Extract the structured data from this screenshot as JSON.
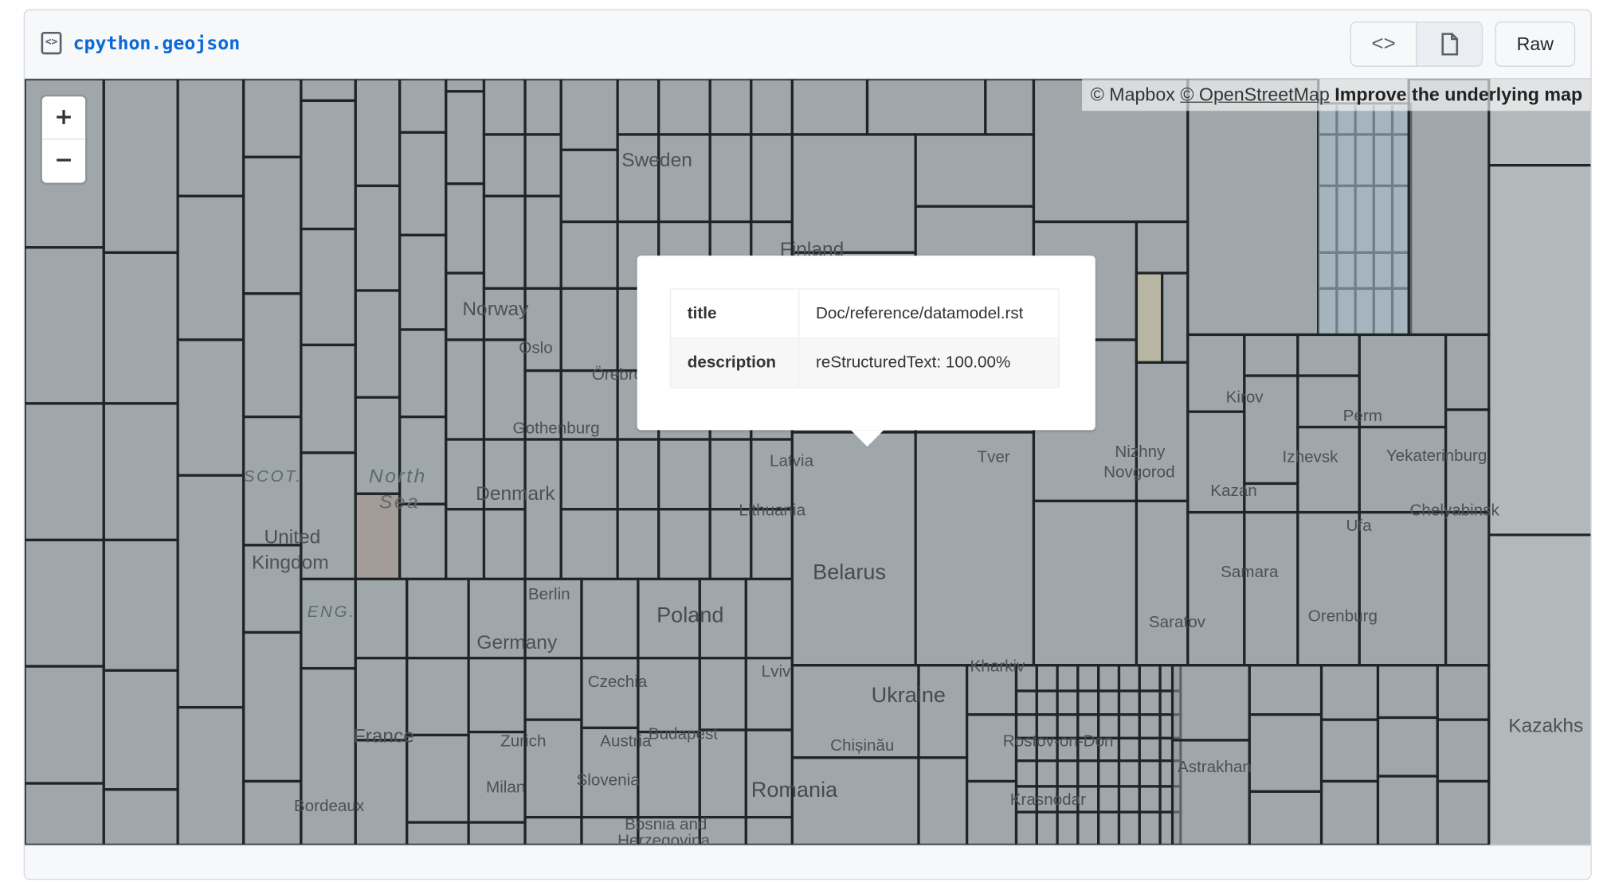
{
  "header": {
    "file_icon": "file-code-icon",
    "file_name": "cpython.geojson",
    "code_view_icon": "code-icon",
    "preview_icon": "file-icon",
    "raw_label": "Raw"
  },
  "map": {
    "zoom_in": "+",
    "zoom_out": "−",
    "attribution": {
      "mapbox": "© Mapbox",
      "osm": "© OpenStreetMap",
      "improve": "Improve the underlying map"
    },
    "labels": [
      "Sweden",
      "Finland",
      "Norway",
      "Oslo",
      "Örebro",
      "Gothenburg",
      "Denmark",
      "North",
      "Sea",
      "SCOT.",
      "United",
      "Kingdom",
      "ENG.",
      "Latvia",
      "Lithuania",
      "Belarus",
      "Berlin",
      "Poland",
      "Germany",
      "Czechia",
      "Lviv",
      "France",
      "Zurich",
      "Austria",
      "Budapest",
      "Milan",
      "Slovenia",
      "Bordeaux",
      "Bosnia and",
      "Herzegovina",
      "Romania",
      "Ukraine",
      "Chișinău",
      "Kharkiv",
      "Rostov-on-Don",
      "Krasnodar",
      "Astrakhan",
      "Tver",
      "Nizhny",
      "Novgorod",
      "Kazan",
      "Kirov",
      "Perm",
      "Izhevsk",
      "Yekaterinburg",
      "Chelyabinsk",
      "Ufa",
      "Samara",
      "Saratov",
      "Orenburg",
      "Kazakhs"
    ],
    "colors": {
      "cell": "#8f999c",
      "border": "#1f2426",
      "highlight_blue": "#a8bccb",
      "highlight_tan": "#b8b5a2",
      "highlight_brown": "#a39c98"
    }
  },
  "popup": {
    "rows": [
      {
        "key": "title",
        "value": "Doc/reference/datamodel.rst"
      },
      {
        "key": "description",
        "value": "reStructuredText: 100.00%"
      }
    ]
  }
}
